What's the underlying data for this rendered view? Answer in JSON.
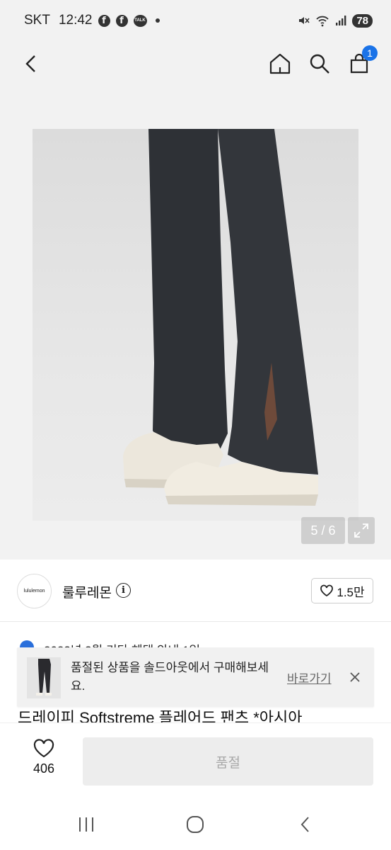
{
  "status_bar": {
    "carrier": "SKT",
    "time": "12:42",
    "battery": "78"
  },
  "header": {
    "cart_count": "1"
  },
  "gallery": {
    "counter": "5 / 6"
  },
  "seller": {
    "logo_text": "lululemon",
    "name": "룰루레몬",
    "likes": "1.5만"
  },
  "notice": {
    "text": "2023년 3월 기타 혜택 안내 1일 ~"
  },
  "toast": {
    "message": "품절된 상품을 솔드아웃에서 구매해보세요.",
    "link_label": "바로가기"
  },
  "product": {
    "title": "드레이피 Softstreme 플레어드 팬츠 *아시아"
  },
  "bottom_bar": {
    "wish_count": "406",
    "cta_label": "품절"
  },
  "colors": {
    "accent": "#1a73e8",
    "disabled_bg": "#ededed",
    "disabled_text": "#a8a8a8"
  }
}
